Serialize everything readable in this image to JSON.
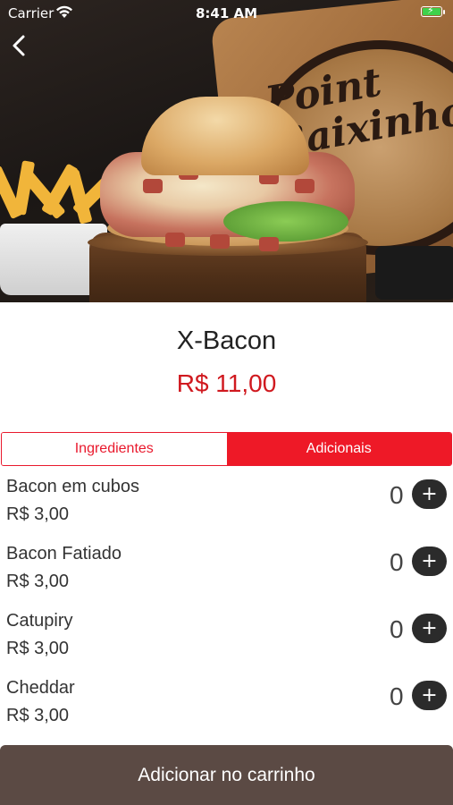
{
  "status_bar": {
    "carrier": "Carrier",
    "time": "8:41 AM",
    "battery_color": "#3fd14b"
  },
  "hero": {
    "sign_line1": "Point",
    "sign_line2": "Baixinho"
  },
  "product": {
    "name": "X-Bacon",
    "price": "R$ 11,00"
  },
  "tabs": [
    {
      "label": "Ingredientes",
      "active": false
    },
    {
      "label": "Adicionais",
      "active": true
    }
  ],
  "extras": [
    {
      "name": "Bacon em cubos",
      "price": "R$ 3,00",
      "qty": "0"
    },
    {
      "name": "Bacon Fatiado",
      "price": "R$ 3,00",
      "qty": "0"
    },
    {
      "name": "Catupiry",
      "price": "R$ 3,00",
      "qty": "0"
    },
    {
      "name": "Cheddar",
      "price": "R$ 3,00",
      "qty": "0"
    }
  ],
  "cart_button": {
    "label": "Adicionar no carrinho"
  },
  "colors": {
    "accent_red": "#ee1927",
    "price_red": "#d0191f",
    "cart_button": "#5b4a44",
    "plus_button": "#2b2b2b"
  }
}
